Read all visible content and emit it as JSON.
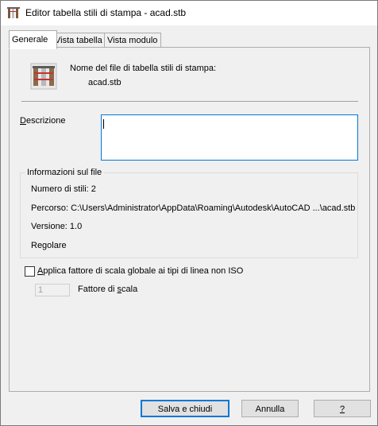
{
  "window": {
    "title": "Editor tabella stili di stampa - acad.stb"
  },
  "tabs": [
    {
      "label": "Generale",
      "active": true
    },
    {
      "label": "Vista tabella",
      "active": false
    },
    {
      "label": "Vista modulo",
      "active": false
    }
  ],
  "general": {
    "file_label": "Nome del file di tabella stili di stampa:",
    "file_name": "acad.stb",
    "description_label": "Descrizione",
    "description_value": "",
    "info": {
      "legend": "Informazioni sul file",
      "style_count": "Numero di stili: 2",
      "path": "Percorso: C:\\Users\\Administrator\\AppData\\Roaming\\Autodesk\\AutoCAD ...\\acad.stb",
      "version": "Versione: 1.0",
      "type": "Regolare"
    },
    "scale_checkbox_label": "Applica fattore di scala globale ai tipi di linea non ISO",
    "scale_checked": false,
    "scale_value": "1",
    "scale_label": "Fattore di scala"
  },
  "buttons": {
    "save": "Salva e chiudi",
    "cancel": "Annulla",
    "help": "?"
  },
  "icons": {
    "title": "plot-style-table-icon",
    "file": "plot-style-table-icon"
  },
  "colors": {
    "focus_border": "#0078d7",
    "background": "#f0f0f0"
  }
}
